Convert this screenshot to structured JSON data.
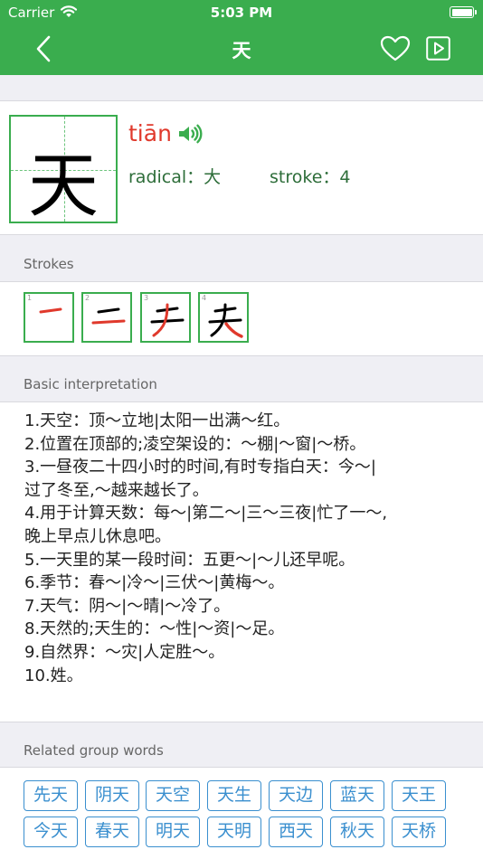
{
  "status_bar": {
    "carrier": "Carrier",
    "time": "5:03 PM"
  },
  "nav": {
    "title": "天",
    "back_icon": "chevron-left-icon",
    "favorite_icon": "heart-icon",
    "play_icon": "play-icon"
  },
  "character": {
    "glyph": "天",
    "pinyin": "tiān",
    "radical_label": "radical：",
    "radical_value": "大",
    "stroke_label": "stroke：",
    "stroke_value": "4"
  },
  "strokes": {
    "heading": "Strokes",
    "steps": [
      {
        "number": "1"
      },
      {
        "number": "2"
      },
      {
        "number": "3"
      },
      {
        "number": "4"
      }
    ]
  },
  "interpretation": {
    "heading": "Basic interpretation",
    "lines": [
      "1.天空：顶～立地|太阳一出满～红。",
      "2.位置在顶部的;凌空架设的：～棚|～窗|～桥。",
      "3.一昼夜二十四小时的时间,有时专指白天：今～|",
      "过了冬至,～越来越长了。",
      "4.用于计算天数：每～|第二～|三～三夜|忙了一～,",
      "晚上早点儿休息吧。",
      "5.一天里的某一段时间：五更～|～儿还早呢。",
      "6.季节：春～|冷～|三伏～|黄梅～。",
      "7.天气：阴～|～晴|～冷了。",
      "8.天然的;天生的：～性|～资|～足。",
      "9.自然界：～灾|人定胜～。",
      "10.姓。"
    ]
  },
  "related": {
    "heading": "Related group words",
    "words": [
      "先天",
      "阴天",
      "天空",
      "天生",
      "天边",
      "蓝天",
      "天王",
      "今天",
      "春天",
      "明天",
      "天明",
      "西天",
      "秋天",
      "天桥"
    ]
  },
  "colors": {
    "brand_green": "#3aad4e",
    "pinyin_red": "#e0392c",
    "chip_blue": "#3a8fcf"
  }
}
